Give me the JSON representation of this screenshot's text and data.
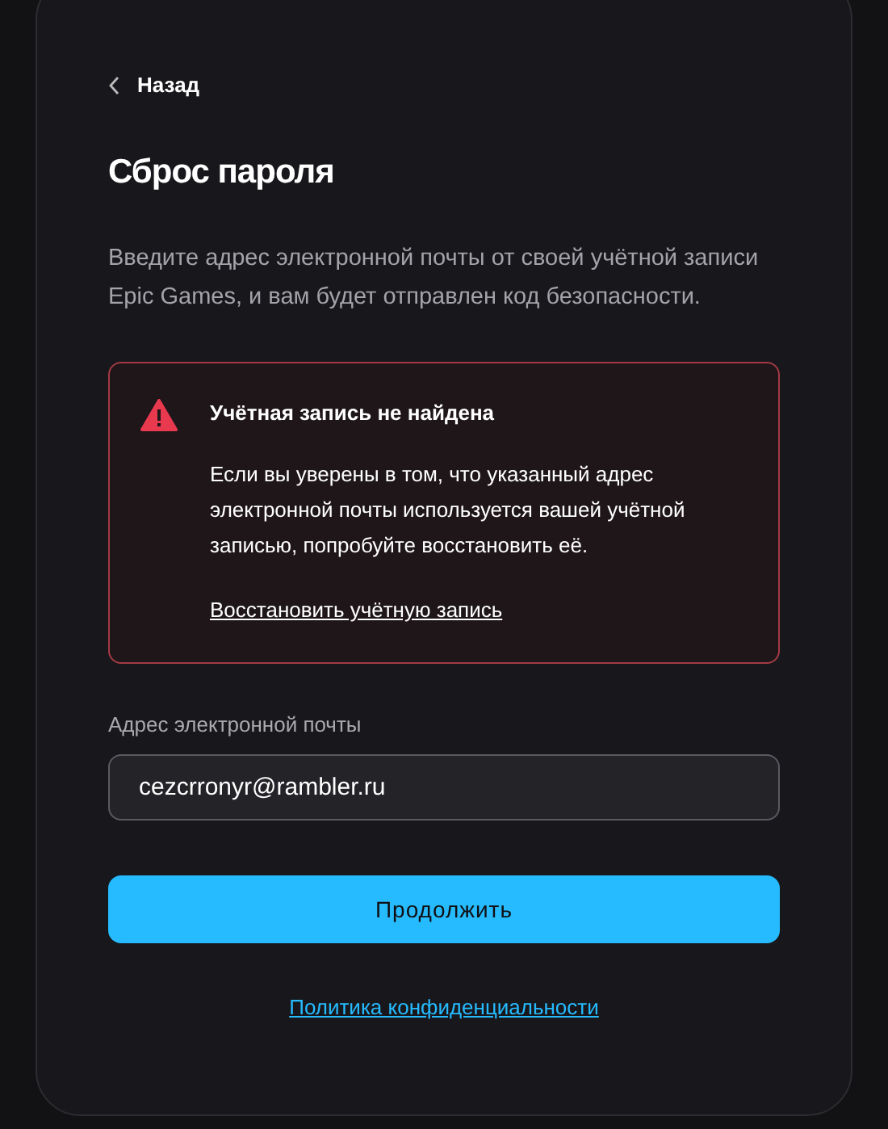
{
  "back_link": {
    "label": "Назад"
  },
  "title": "Сброс пароля",
  "description": "Введите адрес электронной почты от своей учётной записи Epic Games, и вам будет отправлен код безопасности.",
  "alert": {
    "kind": "error",
    "title": "Учётная запись не найдена",
    "message": "Если вы уверены в том, что указанный адрес электронной почты используется вашей учётной записью, попробуйте восстановить её.",
    "link": "Восстановить учётную запись"
  },
  "email_field": {
    "label": "Адрес электронной почты",
    "value": "cezcrronyr@rambler.ru"
  },
  "continue_button": "Продолжить",
  "privacy_link": "Политика конфиденциальности"
}
